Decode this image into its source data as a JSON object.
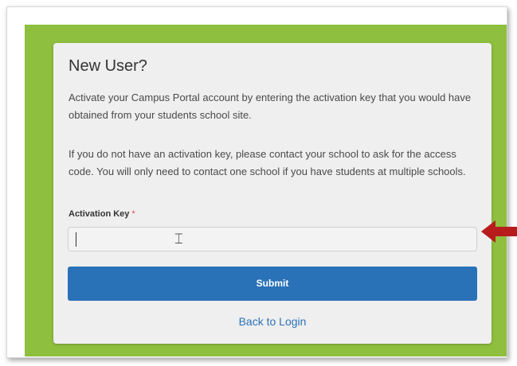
{
  "card": {
    "title": "New User?",
    "paragraph1": "Activate your Campus Portal account by entering the activation key that you would have obtained from your students school site.",
    "paragraph2": "If you do not have an activation key, please contact your school to ask for the access code.  You will only need to contact one school if you have students at multiple schools.",
    "field_label": "Activation Key",
    "required_marker": "*",
    "activation_key_value": "",
    "submit_label": "Submit",
    "back_label": "Back to Login"
  },
  "colors": {
    "background_green": "#8fbf3f",
    "card_bg": "#efefef",
    "primary_blue": "#2a72b8",
    "required_red": "#d9534f",
    "annotation_arrow": "#b71c1c"
  },
  "icons": {
    "text_cursor": "i-beam-cursor-icon",
    "annotation": "left-arrow-icon"
  }
}
